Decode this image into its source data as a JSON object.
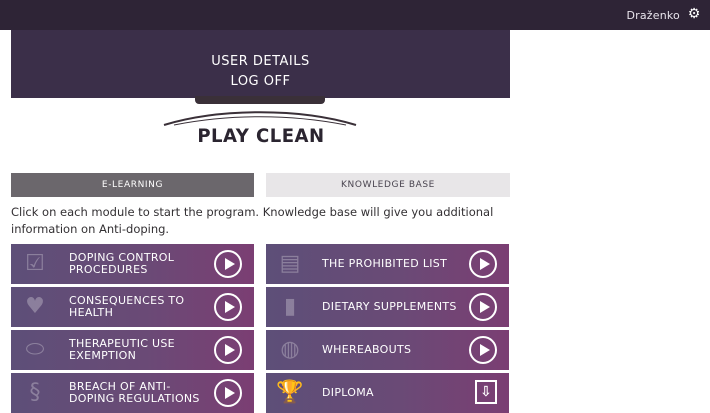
{
  "topbar": {
    "user_name": "Draženko",
    "settings_icon": "gear-icon"
  },
  "user_menu": {
    "details_label": "USER DETAILS",
    "logoff_label": "LOG OFF"
  },
  "logo": {
    "text": "PLAY CLEAN"
  },
  "tabs": {
    "elearning": "E-LEARNING",
    "knowledge": "KNOWLEDGE BASE"
  },
  "intro": "Click on each module to start the program. Knowledge base will give you additional information on Anti-doping.",
  "modules": [
    {
      "label": "DOPING CONTROL PROCEDURES",
      "icon": "checkbox-icon"
    },
    {
      "label": "THE PROHIBITED LIST",
      "icon": "document-icon"
    },
    {
      "label": "CONSEQUENCES TO HEALTH",
      "icon": "heart-icon"
    },
    {
      "label": "DIETARY SUPPLEMENTS",
      "icon": "supplement-jar-icon"
    },
    {
      "label": "THERAPEUTIC USE EXEMPTION",
      "icon": "pill-icon"
    },
    {
      "label": "WHEREABOUTS",
      "icon": "globe-icon"
    },
    {
      "label": "BREACH OF ANTI-DOPING REGULATIONS",
      "icon": "section-sign-icon"
    },
    {
      "label": "DIPLOMA",
      "icon": "trophy-icon"
    }
  ],
  "colors": {
    "topbar": "#2e2436",
    "menu": "#3b2f49",
    "module_start": "#5d4f78",
    "module_end": "#7b3e73",
    "tab_active": "#6b676c",
    "tab_inactive": "#e8e6e8"
  }
}
